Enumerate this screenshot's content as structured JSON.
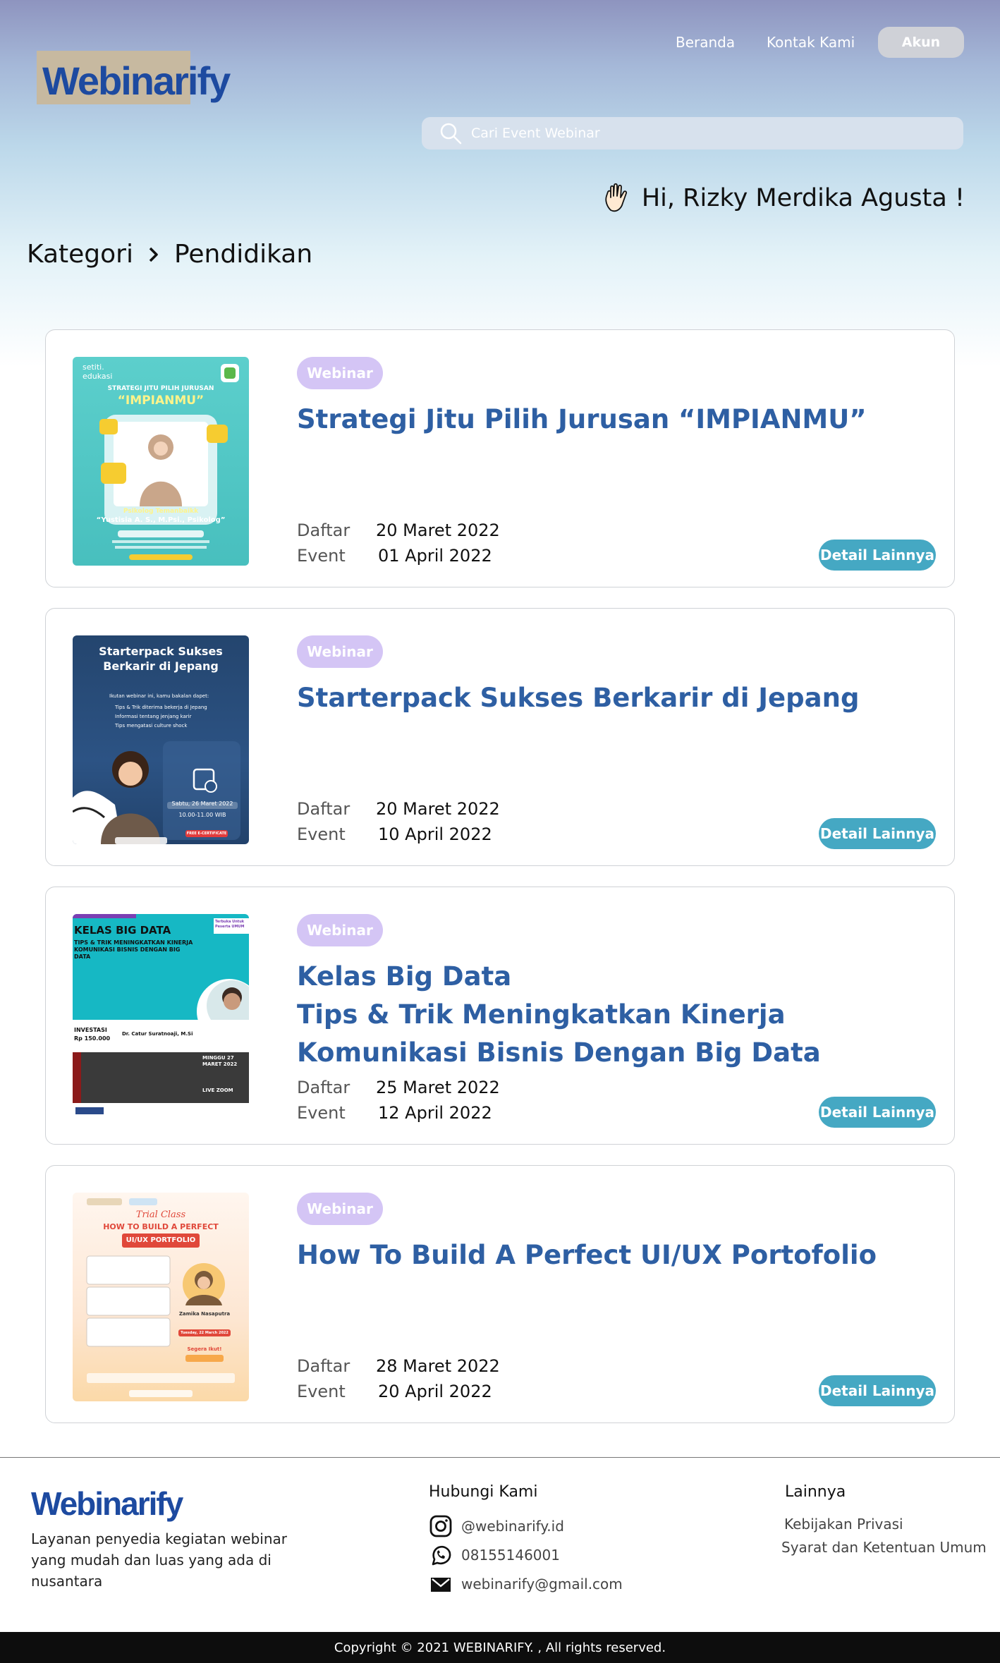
{
  "header": {
    "logo": "Webinarify",
    "nav": {
      "home": "Beranda",
      "contact": "Kontak Kami",
      "account": "Akun"
    },
    "search": {
      "placeholder": "Cari Event Webinar"
    },
    "greeting": "Hi, Rizky Merdika Agusta !"
  },
  "breadcrumb": {
    "parent": "Kategori",
    "current": "Pendidikan"
  },
  "events": [
    {
      "badge": "Webinar",
      "title_lines": [
        "Strategi Jitu Pilih Jurusan “IMPIANMU”"
      ],
      "register_label": "Daftar",
      "register_date": "20 Maret 2022",
      "event_label": "Event",
      "event_date": "01 April 2022",
      "button": "Detail Lainnya",
      "poster": {
        "brand": "setiti.\nedukasi",
        "heading": "STRATEGI JITU PILIH JURUSAN",
        "heading_big": "“IMPIANMU”",
        "speaker_role": "Psikolog Temanbaikk",
        "speaker": "“Yustisia A. S., M.Psi., Psikolog”"
      }
    },
    {
      "badge": "Webinar",
      "title_lines": [
        "Starterpack Sukses Berkarir di Jepang"
      ],
      "register_label": "Daftar",
      "register_date": "20 Maret 2022",
      "event_label": "Event",
      "event_date": "10 April 2022",
      "button": "Detail Lainnya",
      "poster": {
        "heading": "Starterpack Sukses Berkarir di Jepang",
        "intro": "Ikutan webinar ini, kamu bakalan dapet:",
        "points": [
          "Tips & Trik diterima bekerja di Jepang",
          "Informasi tentang jenjang karir",
          "Tips mengatasi culture shock"
        ],
        "date": "Sabtu, 26 Maret 2022",
        "time": "10.00-11.00 WIB",
        "cert": "FREE E-CERTIFICATE"
      }
    },
    {
      "badge": "Webinar",
      "title_lines": [
        "Kelas Big Data",
        "Tips & Trik Meningkatkan Kinerja",
        "Komunikasi Bisnis Dengan Big Data"
      ],
      "register_label": "Daftar",
      "register_date": "25 Maret 2022",
      "event_label": "Event",
      "event_date": "12 April 2022",
      "button": "Detail Lainnya",
      "poster": {
        "heading": "KELAS BIG DATA",
        "sub": "TIPS & TRIK MENINGKATKAN KINERJA KOMUNIKASI BISNIS DENGAN BIG DATA",
        "tag": "Terbuka Untuk Peserta UMUM",
        "price_label": "INVESTASI",
        "price": "Rp 150.000",
        "speaker": "Dr. Catur Suratnoaji, M.Si",
        "date": "MINGGU 27 MARET 2022",
        "live": "LIVE ZOOM"
      }
    },
    {
      "badge": "Webinar",
      "title_lines": [
        "How To Build A Perfect UI/UX Portofolio"
      ],
      "register_label": "Daftar",
      "register_date": "28 Maret 2022",
      "event_label": "Event",
      "event_date": "20 April 2022",
      "button": "Detail Lainnya",
      "poster": {
        "kicker": "Trial Class",
        "heading": "HOW TO BUILD A PERFECT",
        "heading_box": "UI/UX PORTFOLIO",
        "speaker": "Zamika Nasaputra",
        "date": "Tuesday, 22 March 2022",
        "cta": "Segera Ikut!"
      }
    }
  ],
  "footer": {
    "logo": "Webinarify",
    "description": "Layanan penyedia kegiatan webinar yang mudah dan luas yang ada di nusantara",
    "contact_heading": "Hubungi Kami",
    "instagram": "@webinarify.id",
    "whatsapp": "08155146001",
    "email": "webinarify@gmail.com",
    "other_heading": "Lainnya",
    "privacy": "Kebijakan Privasi",
    "terms": "Syarat dan Ketentuan Umum",
    "copyright": "Copyright © 2021 WEBINARIFY. , All rights reserved."
  },
  "colors": {
    "brand": "#1d4aa0",
    "title": "#2e5fa3",
    "badge": "#d4c5f5",
    "button": "#45a8c3"
  }
}
